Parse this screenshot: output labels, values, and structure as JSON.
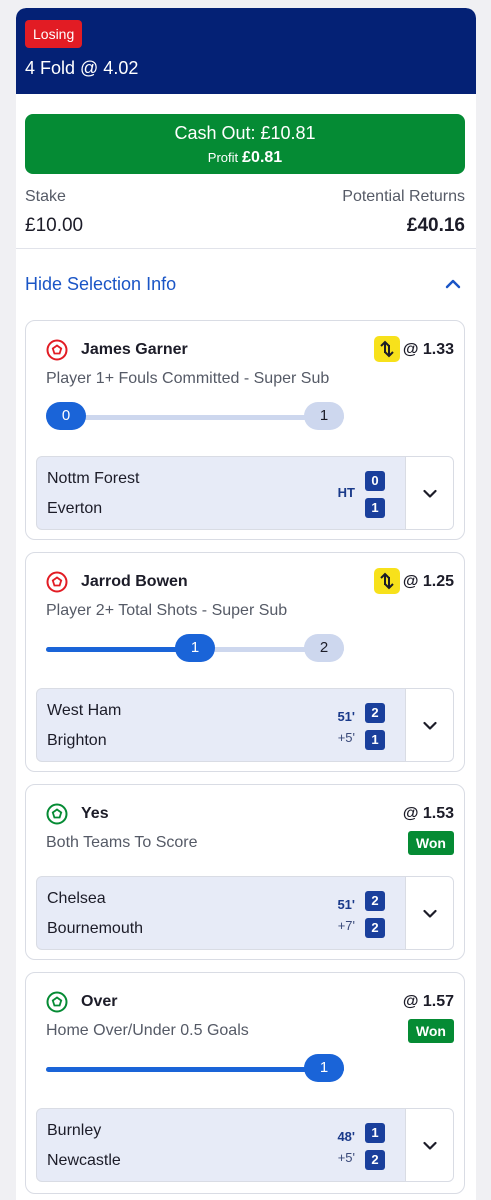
{
  "bet": {
    "status": "Losing",
    "title": "4 Fold @ 4.02",
    "cash_out_label": "Cash Out: £10.81",
    "profit_label": "Profit",
    "profit_value": "£0.81",
    "stake_label": "Stake",
    "stake_value": "£10.00",
    "returns_label": "Potential Returns",
    "returns_value": "£40.16",
    "toggle_label": "Hide Selection Info"
  },
  "colors": {
    "header": "#042175",
    "losing": "#e21c24",
    "cashout": "#058b34",
    "accent": "#1a55c6",
    "won": "#058b34",
    "boost": "#f7e11b"
  },
  "selections": [
    {
      "name": "James Garner",
      "odds": "@ 1.33",
      "market": "Player 1+ Fouls Committed - Super Sub",
      "boost_icon": "super-sub-icon",
      "progress": {
        "current": "0",
        "target": "1",
        "fraction": 0
      },
      "match": {
        "home": "Nottm Forest",
        "away": "Everton",
        "time": "HT",
        "added": "",
        "home_score": "0",
        "away_score": "1"
      }
    },
    {
      "name": "Jarrod Bowen",
      "odds": "@ 1.25",
      "market": "Player 2+ Total Shots - Super Sub",
      "boost_icon": "super-sub-icon",
      "progress": {
        "current": "1",
        "target": "2",
        "fraction": 0.5
      },
      "match": {
        "home": "West Ham",
        "away": "Brighton",
        "time": "51'",
        "added": "+5'",
        "home_score": "2",
        "away_score": "1"
      }
    },
    {
      "name": "Yes",
      "odds": "@ 1.53",
      "market": "Both Teams To Score",
      "status": "Won",
      "match": {
        "home": "Chelsea",
        "away": "Bournemouth",
        "time": "51'",
        "added": "+7'",
        "home_score": "2",
        "away_score": "2"
      }
    },
    {
      "name": "Over",
      "odds": "@ 1.57",
      "market": "Home Over/Under 0.5 Goals",
      "status": "Won",
      "progress": {
        "current": "1",
        "fraction": 1
      },
      "match": {
        "home": "Burnley",
        "away": "Newcastle",
        "time": "48'",
        "added": "+5'",
        "home_score": "1",
        "away_score": "2"
      }
    }
  ]
}
